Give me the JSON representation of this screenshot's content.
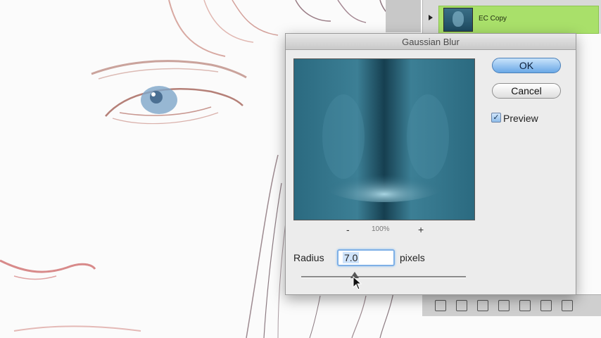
{
  "layers_panel": {
    "layer_name": "EC Copy"
  },
  "dialog": {
    "title": "Gaussian Blur",
    "ok_label": "OK",
    "cancel_label": "Cancel",
    "preview_label": "Preview",
    "preview_checked": "✓",
    "zoom_minus": "-",
    "zoom_plus": "+",
    "zoom_level": "100%",
    "radius_label": "Radius",
    "radius_value": "7.0",
    "units_label": "pixels"
  },
  "colors": {
    "ok_button": "#6aa8e6",
    "layer_highlight": "#a9e06a",
    "preview_teal": "#205466"
  },
  "icons": [
    "layer-thumbnail",
    "disclosure-arrow",
    "checkbox",
    "slider-thumb",
    "mouse-cursor"
  ]
}
